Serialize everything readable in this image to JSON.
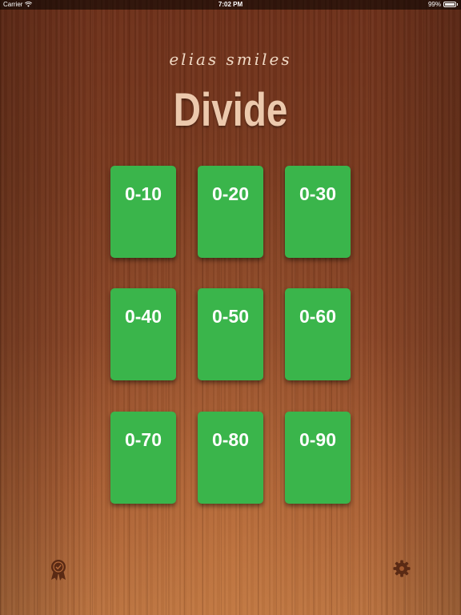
{
  "status_bar": {
    "carrier": "Carrier",
    "time": "7:02 PM",
    "battery": "99%"
  },
  "header": {
    "brand": "elias smiles",
    "title": "Divide"
  },
  "cards": [
    {
      "label": "0-10"
    },
    {
      "label": "0-20"
    },
    {
      "label": "0-30"
    },
    {
      "label": "0-40"
    },
    {
      "label": "0-50"
    },
    {
      "label": "0-60"
    },
    {
      "label": "0-70"
    },
    {
      "label": "0-80"
    },
    {
      "label": "0-90"
    }
  ],
  "colors": {
    "card": "#3ab54b",
    "title": "#ecc9ad",
    "icon": "#5a2a14"
  },
  "footer": {
    "left_icon": "award-ribbon-icon",
    "right_icon": "gear-icon"
  }
}
